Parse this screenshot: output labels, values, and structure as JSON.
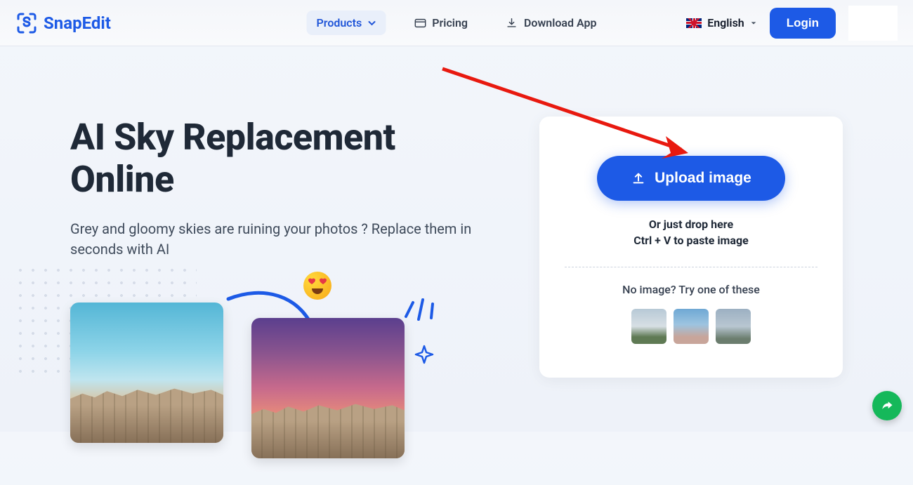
{
  "brand": "SnapEdit",
  "nav": {
    "products": "Products",
    "pricing": "Pricing",
    "download": "Download App"
  },
  "lang": {
    "label": "English"
  },
  "login": "Login",
  "hero": {
    "title": "AI Sky Replacement Online",
    "desc": "Grey and gloomy skies are ruining your photos ? Replace them in seconds with AI"
  },
  "upload": {
    "button": "Upload image",
    "drop": "Or just drop here",
    "paste": "Ctrl + V to paste image",
    "noimg": "No image? Try one of these"
  }
}
